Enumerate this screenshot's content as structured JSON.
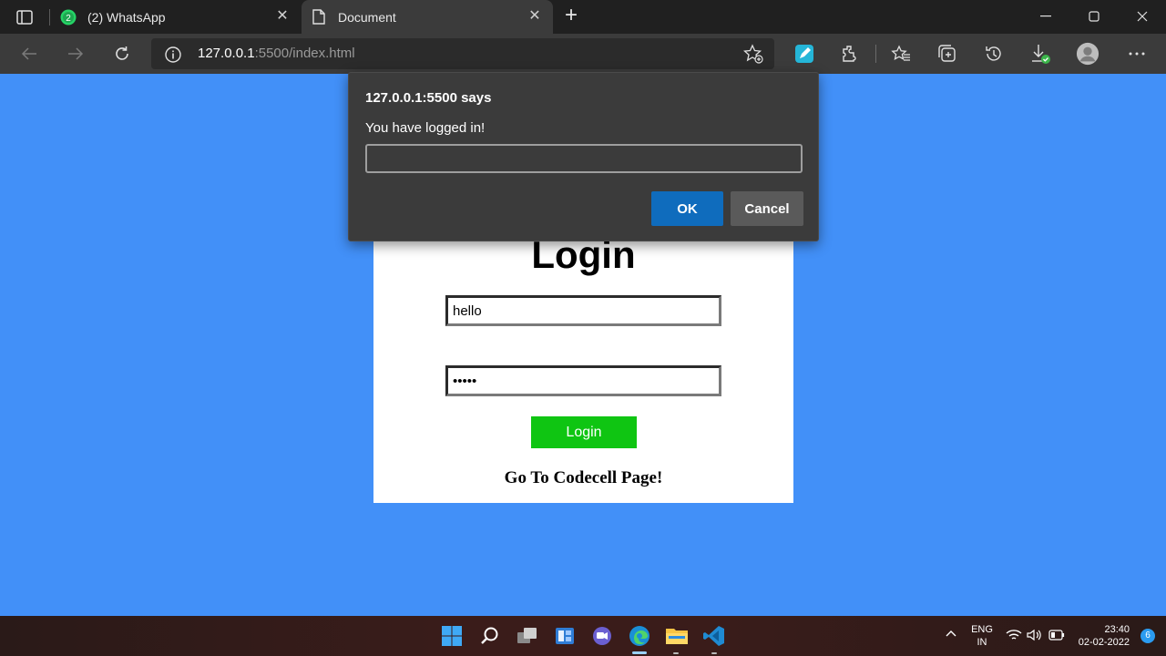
{
  "browser": {
    "tabs": [
      {
        "label": "(2) WhatsApp",
        "badge": "2",
        "icon": "whatsapp-icon"
      },
      {
        "label": "Document",
        "icon": "document-icon",
        "active": true
      }
    ],
    "address": {
      "host": "127.0.0.1",
      "rest": ":5500/index.html"
    }
  },
  "page": {
    "background": "#4290f8",
    "title": "Login",
    "username_value": "hello",
    "password_value": "•••••",
    "login_label": "Login",
    "link_text": "Go To Codecell Page!"
  },
  "dialog": {
    "title": "127.0.0.1:5500 says",
    "message": "You have logged in!",
    "input_value": "",
    "ok_label": "OK",
    "cancel_label": "Cancel"
  },
  "taskbar": {
    "language_line1": "ENG",
    "language_line2": "IN",
    "time": "23:40",
    "date": "02-02-2022",
    "notifications": "6"
  },
  "colors": {
    "accent_blue": "#0f6cbd",
    "login_green": "#0fc512"
  }
}
